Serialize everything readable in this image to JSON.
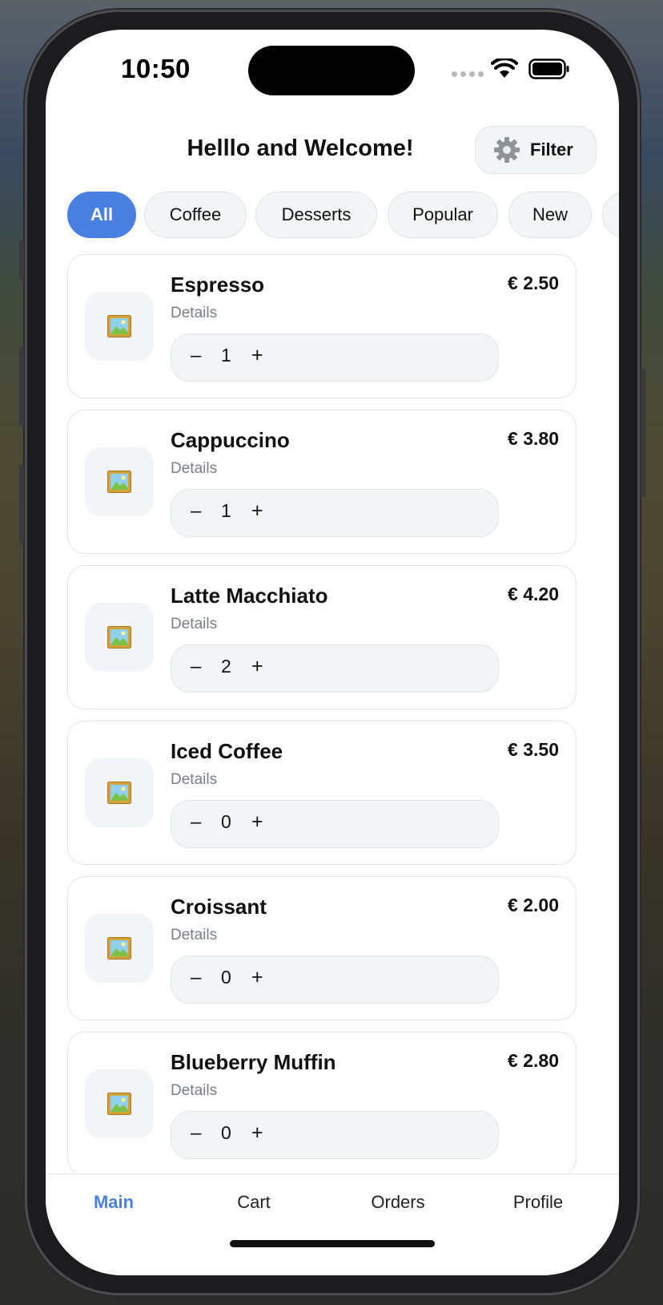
{
  "status_bar": {
    "time": "10:50"
  },
  "header": {
    "title": "Helllo and Welcome!",
    "filter_label": "Filter"
  },
  "categories": [
    {
      "label": "All",
      "active": true
    },
    {
      "label": "Coffee",
      "active": false
    },
    {
      "label": "Desserts",
      "active": false
    },
    {
      "label": "Popular",
      "active": false
    },
    {
      "label": "New",
      "active": false
    }
  ],
  "items": [
    {
      "name": "Espresso",
      "details": "Details",
      "price": "€ 2.50",
      "qty": "1"
    },
    {
      "name": "Cappuccino",
      "details": "Details",
      "price": "€ 3.80",
      "qty": "1"
    },
    {
      "name": "Latte Macchiato",
      "details": "Details",
      "price": "€ 4.20",
      "qty": "2"
    },
    {
      "name": "Iced Coffee",
      "details": "Details",
      "price": "€ 3.50",
      "qty": "0"
    },
    {
      "name": "Croissant",
      "details": "Details",
      "price": "€ 2.00",
      "qty": "0"
    },
    {
      "name": "Blueberry Muffin",
      "details": "Details",
      "price": "€ 2.80",
      "qty": "0"
    }
  ],
  "stepper": {
    "minus": "–",
    "plus": "+"
  },
  "tabbar": {
    "tabs": [
      {
        "label": "Main",
        "active": true
      },
      {
        "label": "Cart",
        "active": false
      },
      {
        "label": "Orders",
        "active": false
      },
      {
        "label": "Profile",
        "active": false
      }
    ]
  },
  "colors": {
    "accent": "#4a7fe2",
    "chip_bg": "#f3f4f6",
    "muted_text": "#7b7e86"
  }
}
